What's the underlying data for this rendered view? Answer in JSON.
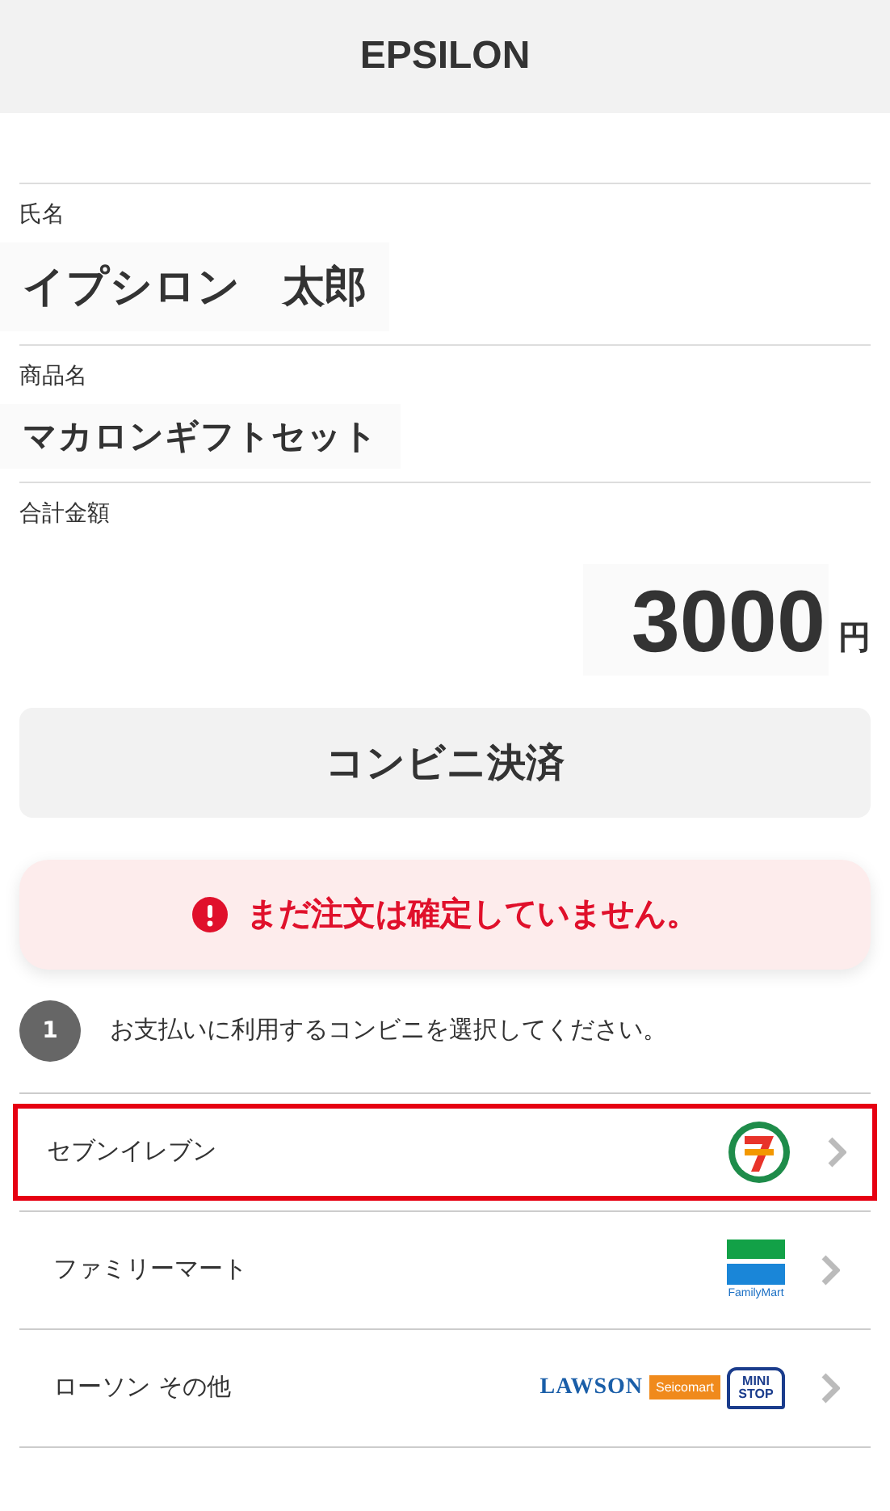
{
  "header": {
    "title": "EPSILON"
  },
  "fields": [
    {
      "label": "氏名",
      "value": "イプシロン　太郎",
      "kind": "name"
    },
    {
      "label": "商品名",
      "value": "マカロンギフトセット",
      "kind": "product"
    }
  ],
  "total": {
    "label": "合計金額",
    "amount": "3000",
    "unit": "円"
  },
  "payment_method": {
    "label": "コンビニ決済"
  },
  "alert": {
    "text": "まだ注文は確定していません。"
  },
  "step": {
    "number": "1",
    "text": "お支払いに利用するコンビニを選択してください。"
  },
  "stores": [
    {
      "name": "セブンイレブン",
      "selected": true,
      "logos": [
        {
          "kind": "seven"
        }
      ]
    },
    {
      "name": "ファミリーマート",
      "selected": false,
      "logos": [
        {
          "kind": "family",
          "text": "FamilyMart"
        }
      ]
    },
    {
      "name": "ローソン その他",
      "selected": false,
      "logos": [
        {
          "kind": "lawson",
          "text": "LAWSON"
        },
        {
          "kind": "seico",
          "text": "Seicomart"
        },
        {
          "kind": "ministop",
          "text": "MINI STOP"
        }
      ]
    }
  ]
}
